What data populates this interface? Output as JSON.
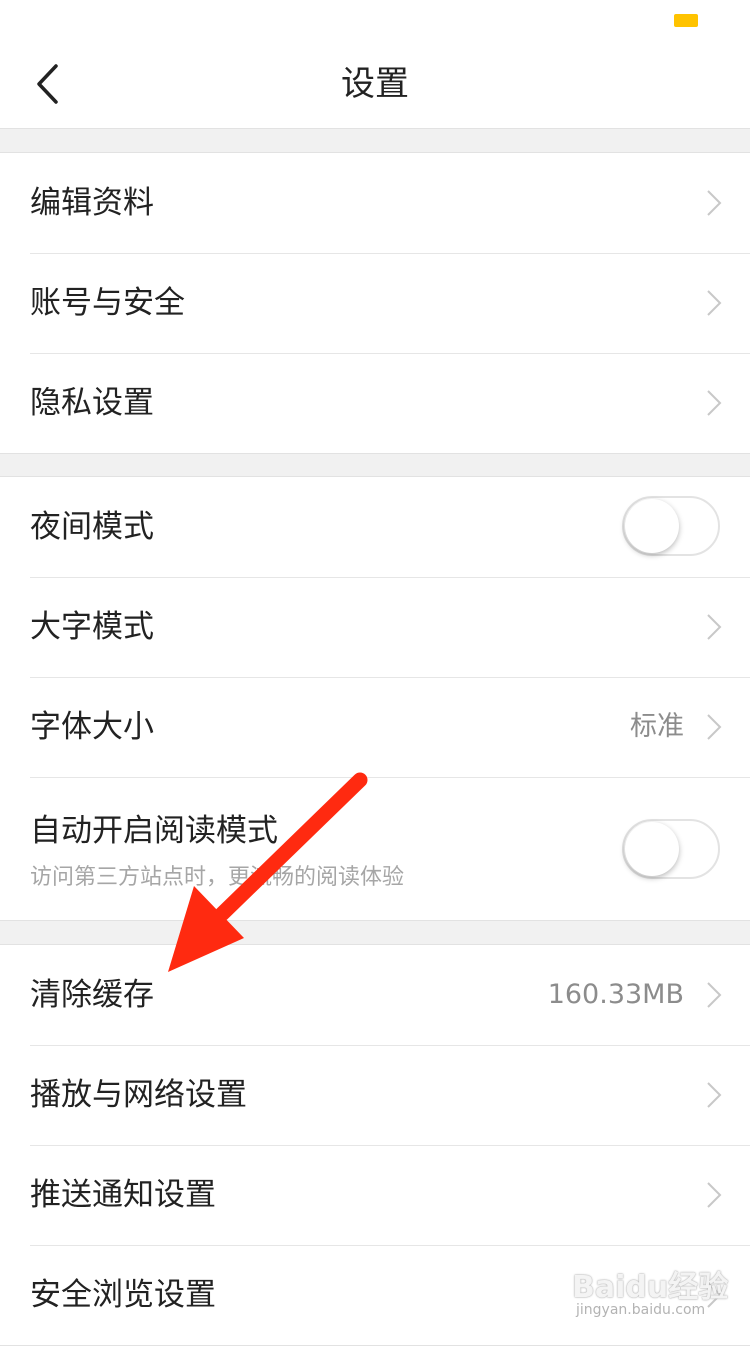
{
  "status_bar": {
    "battery_color": "#ffc300"
  },
  "header": {
    "back_icon": "chevron-left-icon",
    "title": "设置"
  },
  "groups": [
    {
      "items": [
        {
          "label": "编辑资料",
          "control": "chevron"
        },
        {
          "label": "账号与安全",
          "control": "chevron"
        },
        {
          "label": "隐私设置",
          "control": "chevron"
        }
      ]
    },
    {
      "items": [
        {
          "label": "夜间模式",
          "control": "toggle",
          "checked": false
        },
        {
          "label": "大字模式",
          "control": "chevron"
        },
        {
          "label": "字体大小",
          "value": "标准",
          "control": "chevron"
        },
        {
          "label": "自动开启阅读模式",
          "sublabel": "访问第三方站点时，更流畅的阅读体验",
          "control": "toggle",
          "checked": false
        }
      ]
    },
    {
      "items": [
        {
          "label": "清除缓存",
          "value": "160.33MB",
          "control": "chevron"
        },
        {
          "label": "播放与网络设置",
          "control": "chevron"
        },
        {
          "label": "推送通知设置",
          "control": "chevron"
        },
        {
          "label": "安全浏览设置",
          "control": "chevron"
        }
      ]
    }
  ],
  "annotation": {
    "arrow_color": "#ff2a10",
    "arrow_icon": "red-arrow-icon"
  },
  "watermark": {
    "main": "Baidu经验",
    "sub": "jingyan.baidu.com"
  },
  "colors": {
    "accent": "#ffc300",
    "background": "#f1f1f1",
    "secondary_text": "#8c8c8c"
  }
}
